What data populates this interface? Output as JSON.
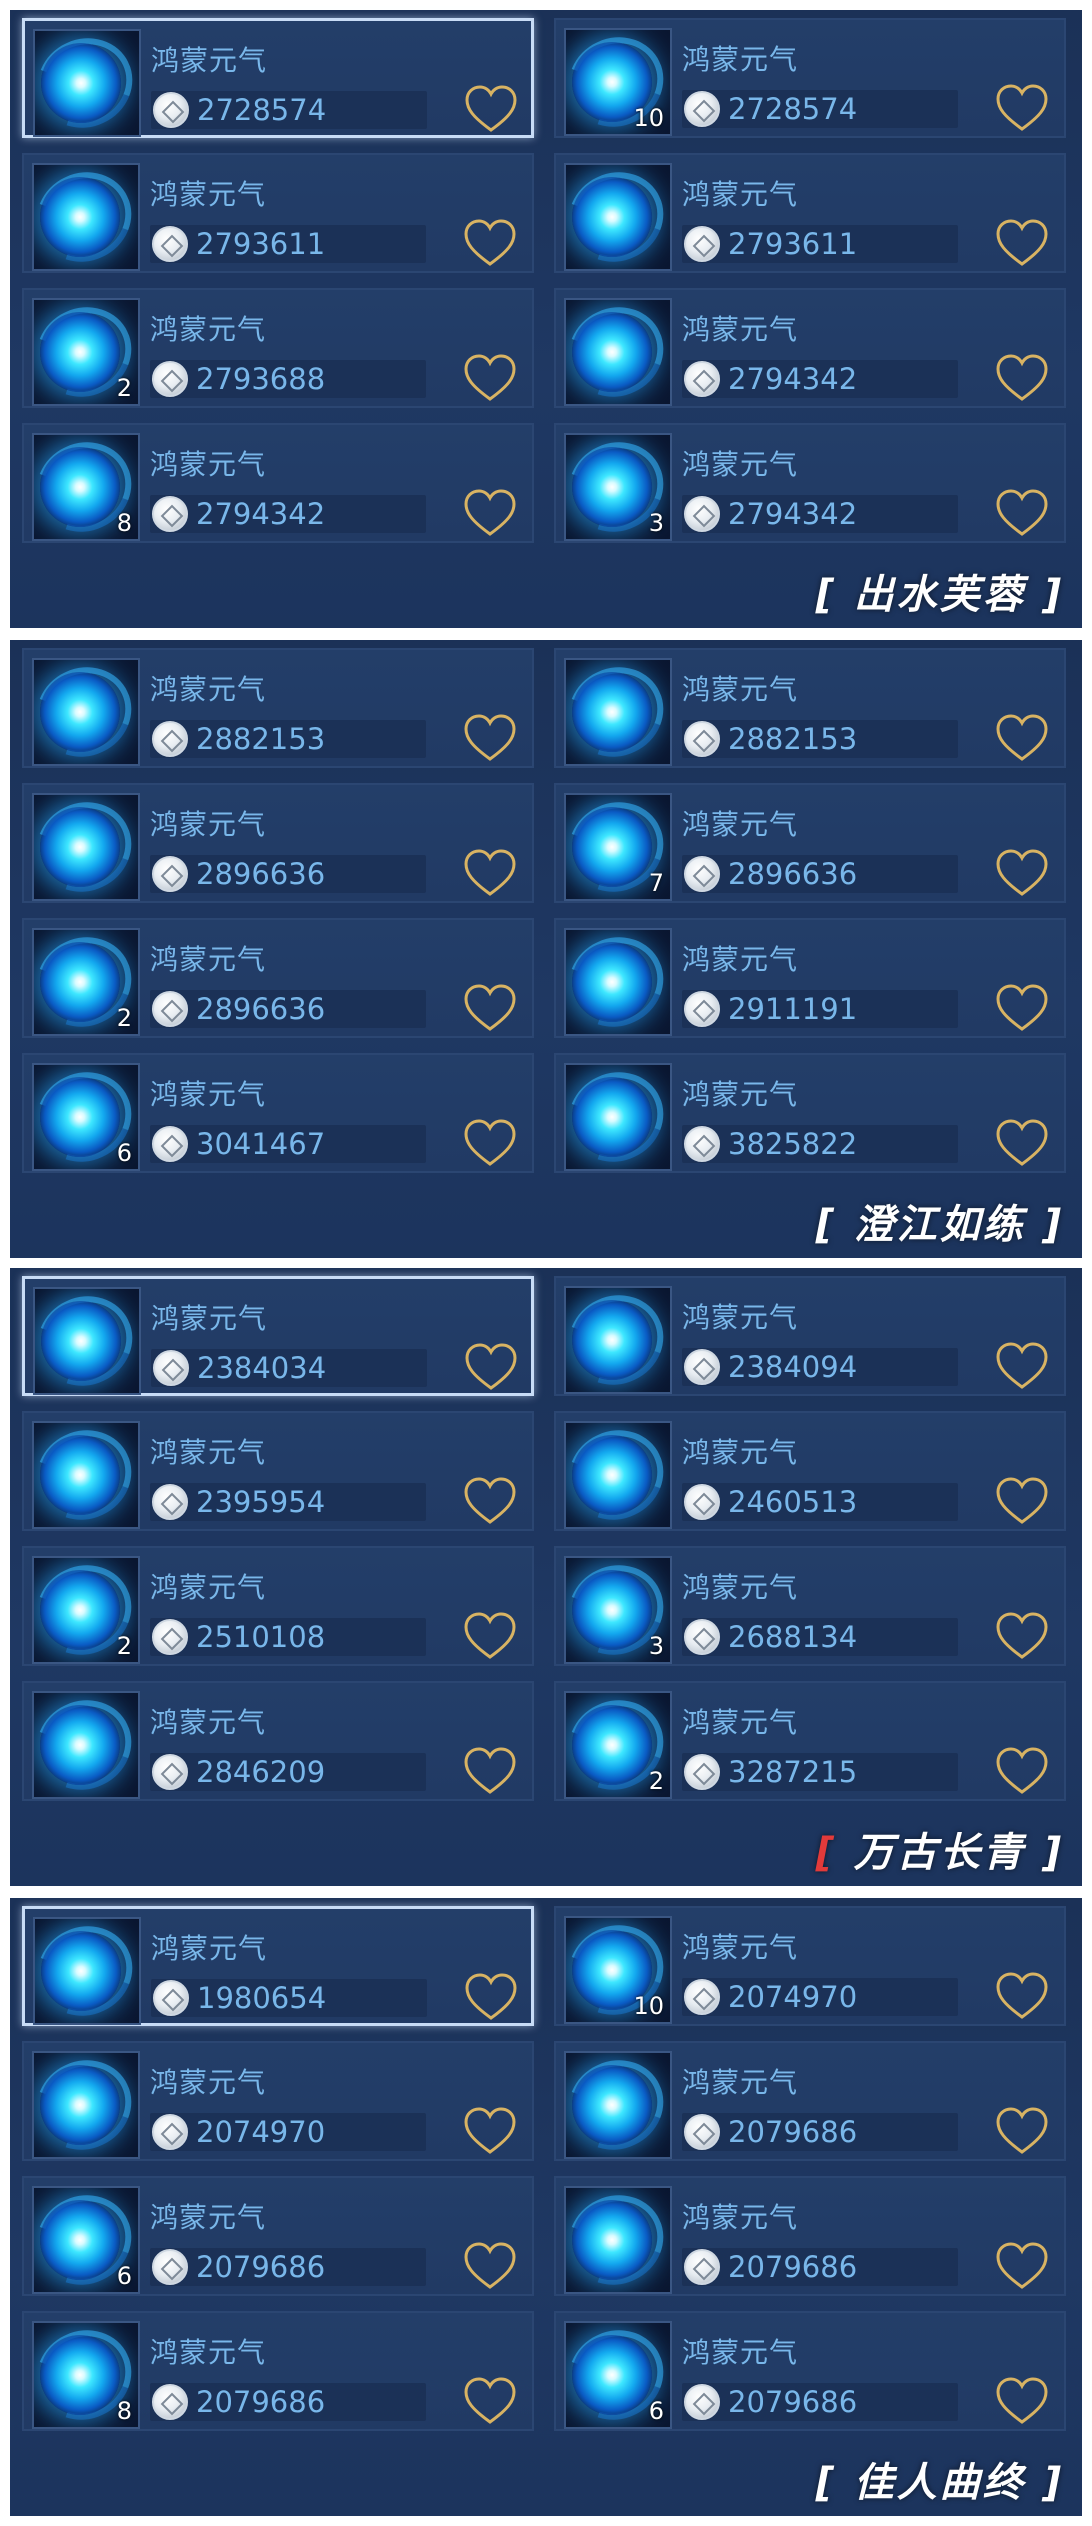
{
  "item_name": "鸿蒙元气",
  "colors": {
    "panel_bg": "#1f3863",
    "card_bg": "#223c67",
    "text_blue": "#79b7ea",
    "heart_gold": "#d8b363",
    "selected_border": "#c8dcf6"
  },
  "sections": [
    {
      "title": "出水芙蓉",
      "items": [
        {
          "name": "鸿蒙元气",
          "price": "2728574",
          "count": "",
          "selected": true
        },
        {
          "name": "鸿蒙元气",
          "price": "2728574",
          "count": "10",
          "selected": false
        },
        {
          "name": "鸿蒙元气",
          "price": "2793611",
          "count": "",
          "selected": false
        },
        {
          "name": "鸿蒙元气",
          "price": "2793611",
          "count": "",
          "selected": false
        },
        {
          "name": "鸿蒙元气",
          "price": "2793688",
          "count": "2",
          "selected": false
        },
        {
          "name": "鸿蒙元气",
          "price": "2794342",
          "count": "",
          "selected": false
        },
        {
          "name": "鸿蒙元气",
          "price": "2794342",
          "count": "8",
          "selected": false
        },
        {
          "name": "鸿蒙元气",
          "price": "2794342",
          "count": "3",
          "selected": false
        }
      ]
    },
    {
      "title": "澄江如练",
      "items": [
        {
          "name": "鸿蒙元气",
          "price": "2882153",
          "count": "",
          "selected": false
        },
        {
          "name": "鸿蒙元气",
          "price": "2882153",
          "count": "",
          "selected": false
        },
        {
          "name": "鸿蒙元气",
          "price": "2896636",
          "count": "",
          "selected": false
        },
        {
          "name": "鸿蒙元气",
          "price": "2896636",
          "count": "7",
          "selected": false
        },
        {
          "name": "鸿蒙元气",
          "price": "2896636",
          "count": "2",
          "selected": false
        },
        {
          "name": "鸿蒙元气",
          "price": "2911191",
          "count": "",
          "selected": false
        },
        {
          "name": "鸿蒙元气",
          "price": "3041467",
          "count": "6",
          "selected": false
        },
        {
          "name": "鸿蒙元气",
          "price": "3825822",
          "count": "",
          "selected": false
        }
      ]
    },
    {
      "title": "万古长青",
      "items": [
        {
          "name": "鸿蒙元气",
          "price": "2384034",
          "count": "",
          "selected": true
        },
        {
          "name": "鸿蒙元气",
          "price": "2384094",
          "count": "",
          "selected": false
        },
        {
          "name": "鸿蒙元气",
          "price": "2395954",
          "count": "",
          "selected": false
        },
        {
          "name": "鸿蒙元气",
          "price": "2460513",
          "count": "",
          "selected": false
        },
        {
          "name": "鸿蒙元气",
          "price": "2510108",
          "count": "2",
          "selected": false
        },
        {
          "name": "鸿蒙元气",
          "price": "2688134",
          "count": "3",
          "selected": false
        },
        {
          "name": "鸿蒙元气",
          "price": "2846209",
          "count": "",
          "selected": false
        },
        {
          "name": "鸿蒙元气",
          "price": "3287215",
          "count": "2",
          "selected": false
        }
      ]
    },
    {
      "title": "佳人曲终",
      "items": [
        {
          "name": "鸿蒙元气",
          "price": "1980654",
          "count": "",
          "selected": true
        },
        {
          "name": "鸿蒙元气",
          "price": "2074970",
          "count": "10",
          "selected": false
        },
        {
          "name": "鸿蒙元气",
          "price": "2074970",
          "count": "",
          "selected": false
        },
        {
          "name": "鸿蒙元气",
          "price": "2079686",
          "count": "",
          "selected": false
        },
        {
          "name": "鸿蒙元气",
          "price": "2079686",
          "count": "6",
          "selected": false
        },
        {
          "name": "鸿蒙元气",
          "price": "2079686",
          "count": "",
          "selected": false
        },
        {
          "name": "鸿蒙元气",
          "price": "2079686",
          "count": "8",
          "selected": false
        },
        {
          "name": "鸿蒙元气",
          "price": "2079686",
          "count": "6",
          "selected": false
        }
      ]
    }
  ]
}
